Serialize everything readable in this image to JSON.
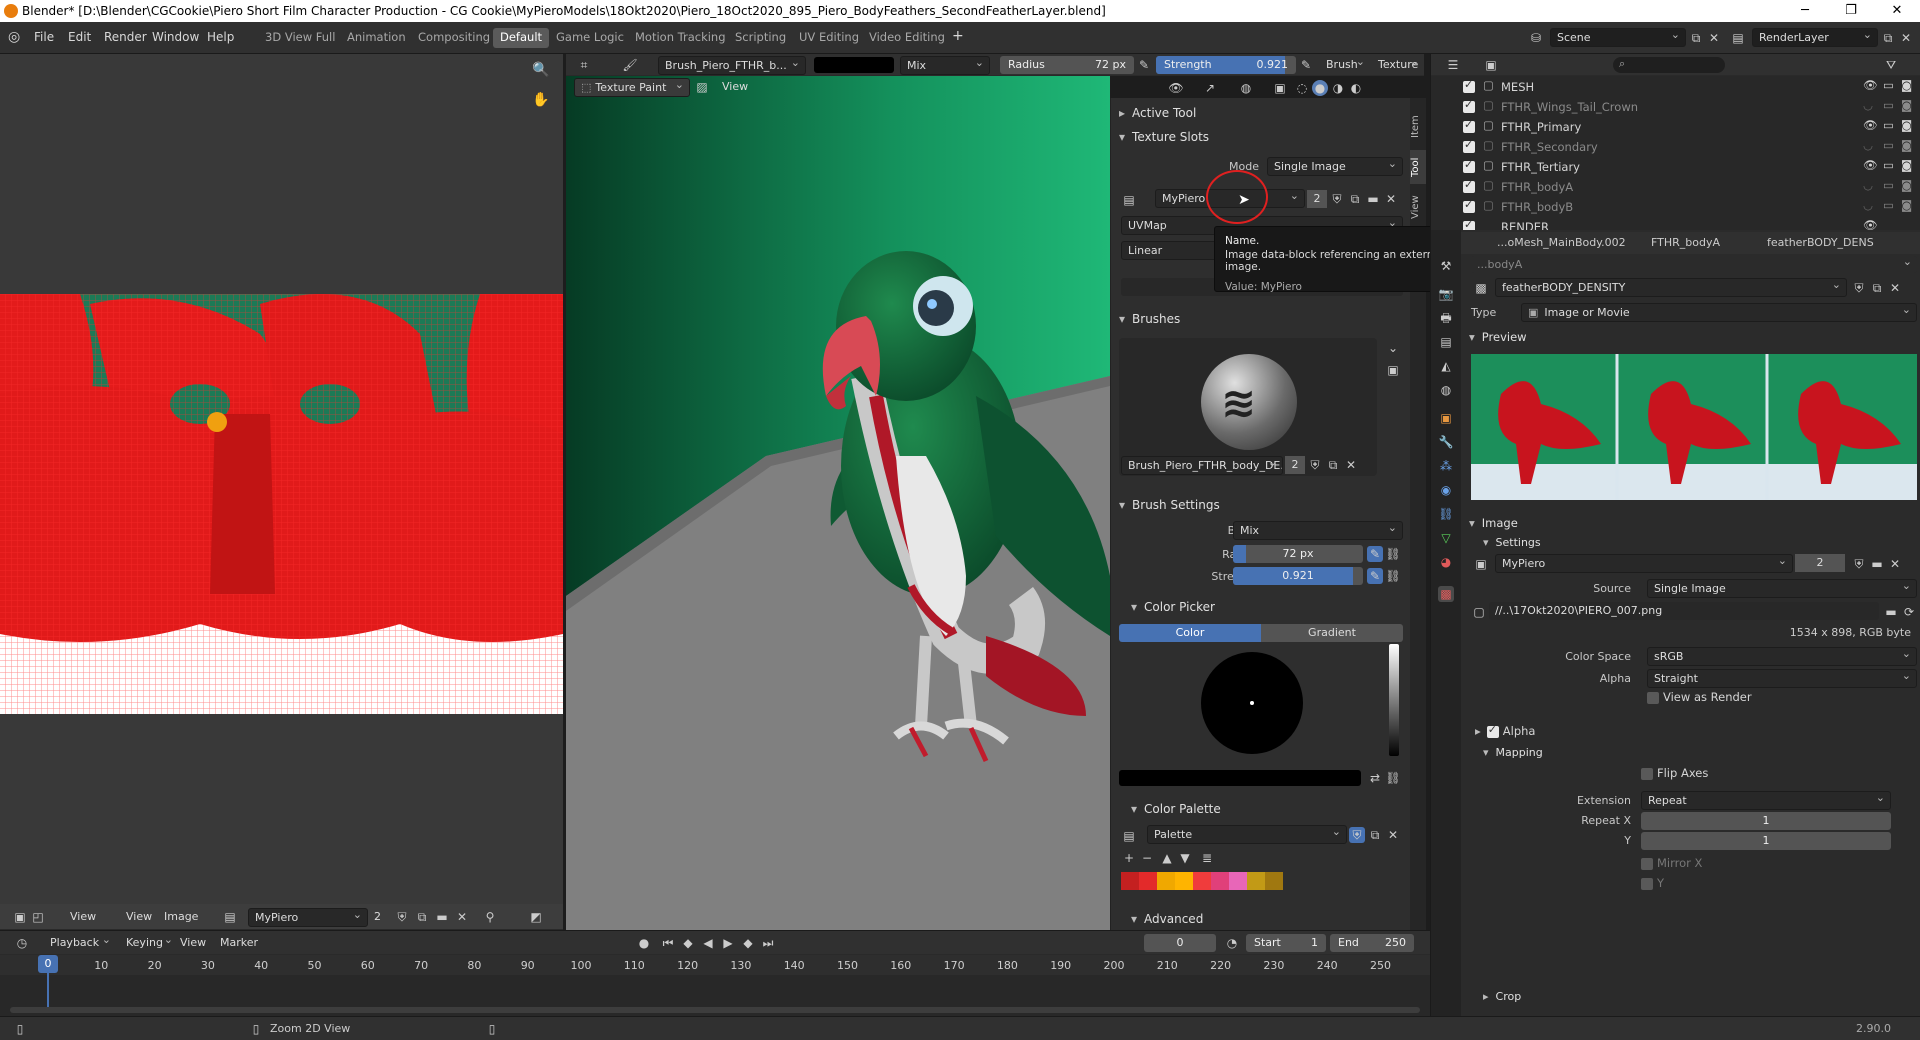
{
  "window": {
    "title": "Blender* [D:\\Blender\\CGCookie\\Piero Short Film Character Production - CG Cookie\\MyPieroModels\\18Okt2020\\Piero_18Oct2020_895_Piero_BodyFeathers_SecondFeatherLayer.blend]"
  },
  "menu": [
    "File",
    "Edit",
    "Render",
    "Window",
    "Help"
  ],
  "workspaces": [
    "3D View Full",
    "Animation",
    "Compositing",
    "Default",
    "Game Logic",
    "Motion Tracking",
    "Scripting",
    "UV Editing",
    "Video Editing"
  ],
  "active_workspace": "Default",
  "scene": {
    "name": "Scene",
    "layer": "RenderLayer"
  },
  "image_editor": {
    "header": {
      "view": "View",
      "view2": "View",
      "image": "Image",
      "image_name": "MyPiero",
      "users": "2"
    }
  },
  "viewport": {
    "header": {
      "brush_name": "Brush_Piero_FTHR_b...",
      "blend": "Mix",
      "radius_label": "Radius",
      "radius_value": "72 px",
      "strength_label": "Strength",
      "strength_value": "0.921",
      "strength_fraction": 0.921,
      "brush_menu": "Brush",
      "texture_menu": "Texture",
      "mode": "Texture Paint",
      "view": "View"
    }
  },
  "sidebar": {
    "tabs": [
      "Item",
      "Tool",
      "View"
    ],
    "active_tool": "Active Tool",
    "texture_slots": "Texture Slots",
    "mode_label": "Mode",
    "mode_value": "Single Image",
    "image_name": "MyPiero",
    "image_users": "2",
    "uvmap": "UVMap",
    "interp": "Linear",
    "tooltip": {
      "title": "Name.",
      "desc": "Image data-block referencing an external or packed image.",
      "value": "Value: MyPiero"
    },
    "brushes": "Brushes",
    "brush_name": "Brush_Piero_FTHR_body_DE...",
    "brush_users": "2",
    "brush_settings": "Brush Settings",
    "blend_label": "Blend",
    "blend_value": "Mix",
    "radius_label": "Radius",
    "radius_value": "72 px",
    "strength_label": "Strength",
    "strength_value": "0.921",
    "color_picker": "Color Picker",
    "color_tab": "Color",
    "gradient_tab": "Gradient",
    "color_palette": "Color Palette",
    "palette_name": "Palette",
    "palette_colors": [
      "#c42020",
      "#e32a2a",
      "#f0a800",
      "#ffb400",
      "#f03c3c",
      "#e0407a",
      "#e866b8",
      "#c29a16",
      "#a07810"
    ],
    "advanced": "Advanced"
  },
  "outliner": {
    "rows": [
      {
        "name": "MESH",
        "visible": true
      },
      {
        "name": "FTHR_Wings_Tail_Crown",
        "visible": false
      },
      {
        "name": "FTHR_Primary",
        "visible": true
      },
      {
        "name": "FTHR_Secondary",
        "visible": false
      },
      {
        "name": "FTHR_Tertiary",
        "visible": true
      },
      {
        "name": "FTHR_bodyA",
        "visible": false
      },
      {
        "name": "FTHR_bodyB",
        "visible": false
      },
      {
        "name": "RENDER",
        "visible": true
      }
    ]
  },
  "properties": {
    "breadcrumb": [
      "...oMesh_MainBody.002",
      "FTHR_bodyA",
      "featherBODY_DENS"
    ],
    "subtitle": "...bodyA",
    "texture_name": "featherBODY_DENSITY",
    "type_label": "Type",
    "type_value": "Image or Movie",
    "preview": "Preview",
    "image_section": "Image",
    "settings": "Settings",
    "image_name": "MyPiero",
    "image_users": "2",
    "source_label": "Source",
    "source_value": "Single Image",
    "filepath": "//..\\17Okt2020\\PIERO_007.png",
    "resolution": "1534 x 898,  RGB byte",
    "colorspace_label": "Color Space",
    "colorspace_value": "sRGB",
    "alpha_label": "Alpha",
    "alpha_value": "Straight",
    "view_as_render": "View as Render",
    "alpha_check": "Alpha",
    "mapping": "Mapping",
    "flip_axes": "Flip Axes",
    "extension_label": "Extension",
    "extension_value": "Repeat",
    "repeat_x_label": "Repeat X",
    "repeat_x": "1",
    "repeat_y_label": "Y",
    "repeat_y": "1",
    "mirror_x": "Mirror X",
    "mirror_y": "Y",
    "crop": "Crop"
  },
  "timeline": {
    "menu": [
      "Playback",
      "Keying",
      "View",
      "Marker"
    ],
    "current_frame": "0",
    "start_label": "Start",
    "start": "1",
    "end_label": "End",
    "end": "250",
    "ticks": [
      "0",
      "10",
      "20",
      "30",
      "40",
      "50",
      "60",
      "70",
      "80",
      "90",
      "100",
      "110",
      "120",
      "130",
      "140",
      "150",
      "160",
      "170",
      "180",
      "190",
      "200",
      "210",
      "220",
      "230",
      "240",
      "250"
    ]
  },
  "statusbar": {
    "hint": "Zoom 2D View",
    "version": "2.90.0"
  },
  "colors": {
    "accent": "#4772b3",
    "feather_red": "#d01020",
    "parrot_green": "#116b3a",
    "bg_green": "#1e9a63"
  }
}
